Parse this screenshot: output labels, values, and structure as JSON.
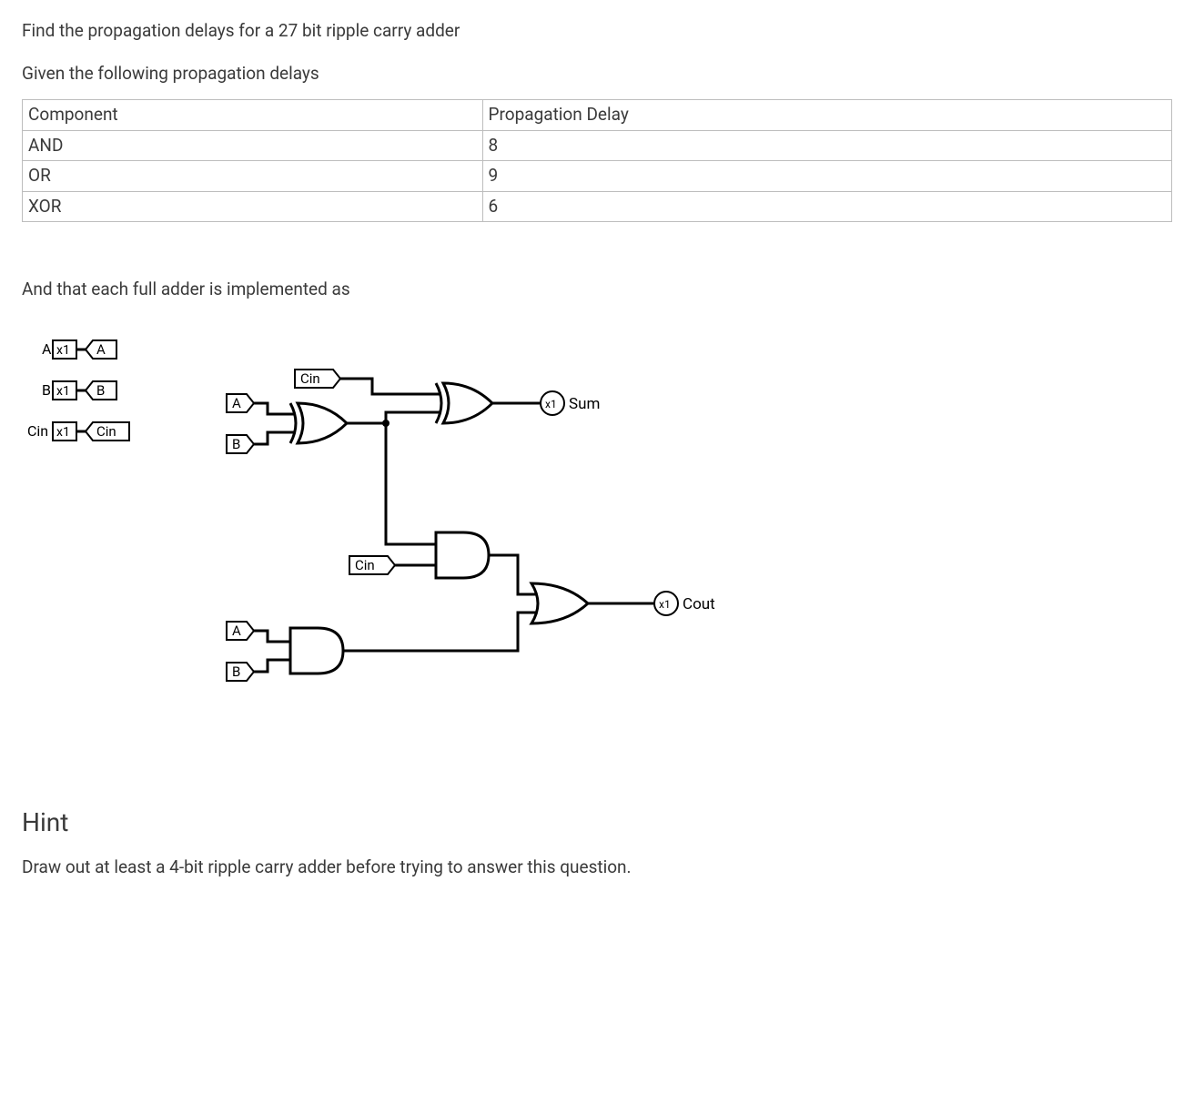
{
  "question": {
    "title": "Find the propagation delays for a 27 bit ripple carry adder",
    "given": "Given the following propagation delays"
  },
  "table": {
    "headers": {
      "col1": "Component",
      "col2": "Propagation Delay"
    },
    "rows": {
      "r1c1": "AND",
      "r1c2": "8",
      "r2c1": "OR",
      "r2c2": "9",
      "r3c1": "XOR",
      "r3c2": "6"
    }
  },
  "implemented": "And that each full adder is implemented as",
  "inputs": {
    "a": "A",
    "a_mult": "x1",
    "a_tag": "A",
    "b": "B",
    "b_mult": "x1",
    "b_tag": "B",
    "cin": "Cin",
    "cin_mult": "x1",
    "cin_tag": "Cin"
  },
  "circuit": {
    "cin_top": "Cin",
    "a_top": "A",
    "b_top": "B",
    "sum_mult": "x1",
    "sum": "Sum",
    "cin_mid": "Cin",
    "a_bot": "A",
    "b_bot": "B",
    "cout_mult": "x1",
    "cout": "Cout"
  },
  "hint": {
    "heading": "Hint",
    "text": "Draw out at least a 4-bit ripple carry adder before trying to answer this question."
  }
}
